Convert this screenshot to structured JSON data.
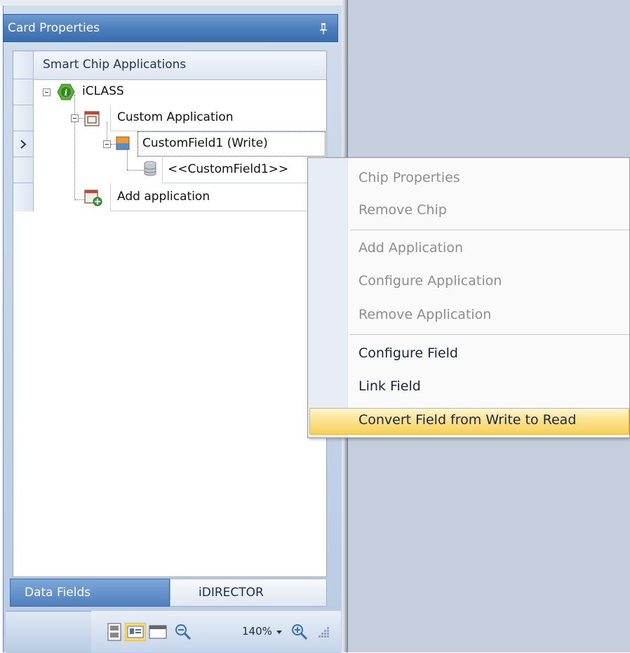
{
  "panel": {
    "title": "Card Properties",
    "grid_header": "Smart Chip Applications",
    "tree": {
      "chip": "iCLASS",
      "application": "Custom Application",
      "field": "CustomField1 (Write)",
      "field_value": "<<CustomField1>>",
      "add_application": "Add application"
    },
    "tabs": [
      "Data Fields",
      "iDIRECTOR"
    ]
  },
  "statusbar": {
    "zoom": "140%"
  },
  "context_menu": {
    "items": [
      {
        "label": "Chip Properties",
        "enabled": false
      },
      {
        "label": "Remove Chip",
        "enabled": false
      },
      {
        "label": "Add Application",
        "enabled": false
      },
      {
        "label": "Configure Application",
        "enabled": false
      },
      {
        "label": "Remove Application",
        "enabled": false
      },
      {
        "label": "Configure Field",
        "enabled": true
      },
      {
        "label": "Link Field",
        "enabled": true
      },
      {
        "label": "Convert Field from Write to Read",
        "enabled": true,
        "highlighted": true
      }
    ]
  },
  "colors": {
    "panel_header": "#4e7fbd",
    "workspace": "#c5cedd",
    "menu_highlight": "#fbe38f"
  }
}
